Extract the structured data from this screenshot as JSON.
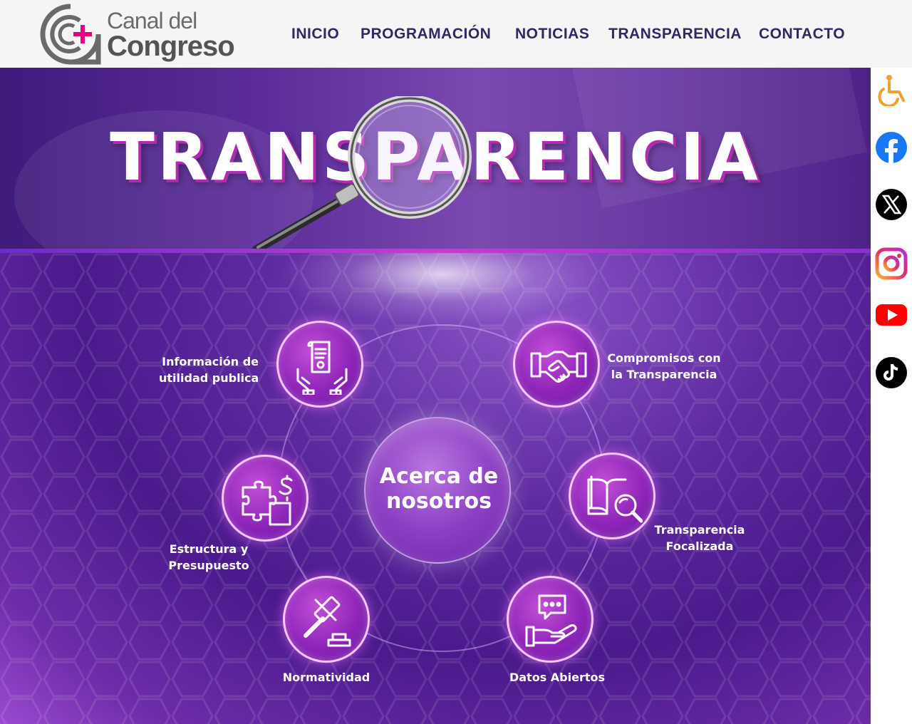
{
  "brand": {
    "logo_top": "Canal del",
    "logo_bottom": "Congreso",
    "accent_color": "#e6007e",
    "logo_gray": "#5a5a5a"
  },
  "nav": {
    "items": [
      {
        "label": "INICIO"
      },
      {
        "label": "PROGRAMACIÓN"
      },
      {
        "label": "NOTICIAS"
      },
      {
        "label": "TRANSPARENCIA"
      },
      {
        "label": "CONTACTO"
      }
    ],
    "color": "#2c2a5e"
  },
  "hero": {
    "title": "TRANSPARENCIA"
  },
  "diagram": {
    "center": {
      "line1": "Acerca de",
      "line2": "nosotros"
    },
    "nodes": [
      {
        "line1": "Información de",
        "line2": "utilidad publica",
        "icon": "document-hands-icon"
      },
      {
        "line1": "Compromisos con",
        "line2": "la Transparencia",
        "icon": "handshake-icon"
      },
      {
        "line1": "Transparencia",
        "line2": "Focalizada",
        "icon": "book-magnifier-icon"
      },
      {
        "line1": "Datos Abiertos",
        "line2": "",
        "icon": "chat-hand-icon"
      },
      {
        "line1": "Normatividad",
        "line2": "",
        "icon": "gavel-icon"
      },
      {
        "line1": "Estructura y",
        "line2": "Presupuesto",
        "icon": "puzzle-dollar-icon"
      }
    ]
  },
  "social": {
    "items": [
      {
        "icon": "accessibility-icon",
        "color": "#f0a030"
      },
      {
        "icon": "facebook-icon",
        "color": "#1877f2"
      },
      {
        "icon": "x-icon",
        "color": "#000000"
      },
      {
        "icon": "instagram-icon",
        "color": "#e1306c"
      },
      {
        "icon": "youtube-icon",
        "color": "#ff0000"
      },
      {
        "icon": "tiktok-icon",
        "color": "#000000"
      }
    ]
  }
}
